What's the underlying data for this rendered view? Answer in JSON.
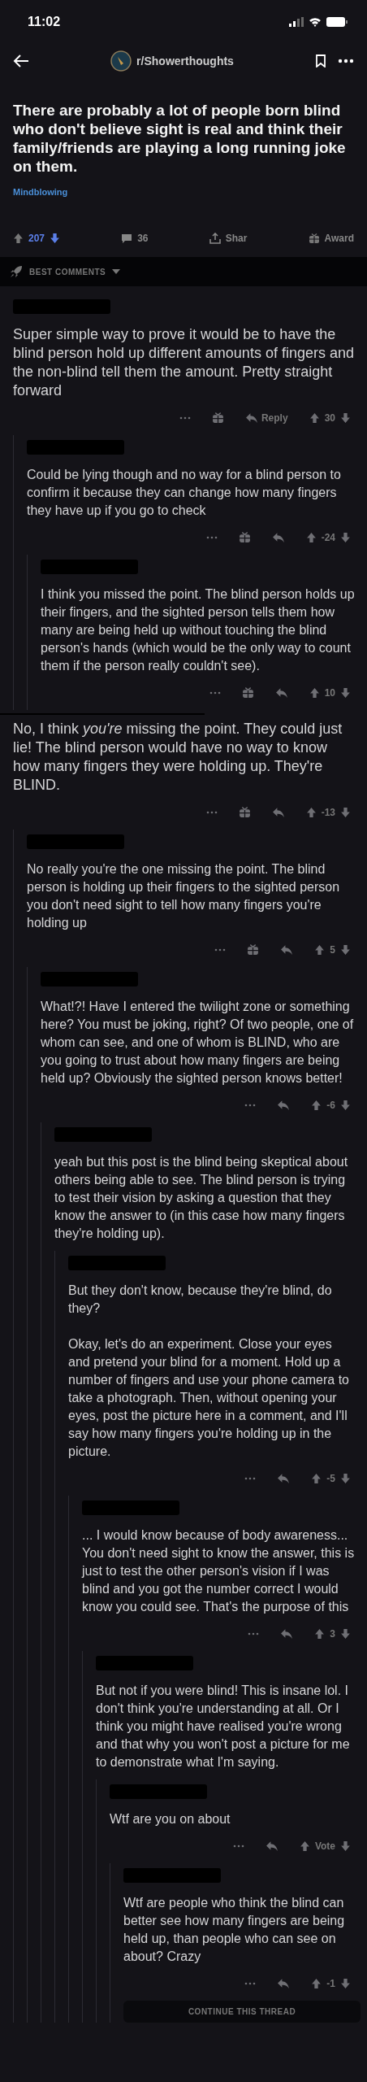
{
  "status_bar": {
    "time": "11:02"
  },
  "header": {
    "subreddit": "r/Showerthoughts"
  },
  "post": {
    "title": "There are probably a lot of people born blind who don't believe sight is real and think their family/friends are playing a long running joke on them.",
    "flair": "Mindblowing",
    "score": "207",
    "upvoted": false,
    "downvoted": true,
    "comments": "36",
    "share": "Shar",
    "award": "Award"
  },
  "sort": {
    "label": "BEST COMMENTS"
  },
  "comments": [
    {
      "text": "Super simple way to prove it would be to have the blind person hold up different amounts of fingers and the non-blind tell them the amount. Pretty straight forward",
      "author_hidden": true,
      "award": true,
      "reply_label": "Reply",
      "score": "30",
      "children": [
        {
          "text": "Could be lying though and no way for a blind person to confirm it because they can change how many fingers they have up if you go to check",
          "author_hidden": true,
          "award": true,
          "score": "-24",
          "children": [
            {
              "text": "I think you missed the point. The blind person holds up their fingers, and the sighted person tells them how many are being held up without touching the blind person's hands (which would be the only way to count them if the person really couldn't see).",
              "author_hidden": true,
              "award": true,
              "score": "10"
            }
          ]
        }
      ]
    },
    {
      "text": "No, I think *you're* missing the point. They could just lie! The blind person would have no way to know how many fingers they were holding up. They're BLIND.",
      "author_hidden": false,
      "award": true,
      "score": "-13",
      "children": [
        {
          "text": "No really you're the one missing the point. The blind person is holding up their fingers to the sighted person you don't need sight to tell how many fingers you're holding up",
          "author_hidden": true,
          "award": true,
          "score": "5",
          "children": [
            {
              "text": "What!?! Have I entered the twilight zone or something here? You must be joking, right? Of two people, one of whom can see, and one of whom is BLIND, who are you going to trust about how many fingers are being held up? Obviously the sighted person knows better!",
              "author_hidden": true,
              "award": false,
              "score": "-6",
              "children": [
                {
                  "text": "yeah but this post is the blind being skeptical about others being able to see. The blind person is trying to test their vision by asking a question that they know the answer to (in this case how many fingers they're holding up).",
                  "author_hidden": true,
                  "children": [
                    {
                      "text": "But they don't know, because they're blind, do they?\n\nOkay, let's do an experiment. Close your eyes and pretend your blind for a moment. Hold up a number of fingers and use your phone camera to take a photograph. Then, without opening your eyes, post the picture here in a comment, and I'll say how many fingers you're holding up in the picture.",
                      "author_hidden": true,
                      "award": false,
                      "score": "-5",
                      "children": [
                        {
                          "text": "... I would know because of body awareness... You don't need sight to know the answer, this is just to test the other person's vision if I was blind and you got the number correct I would know you could see. That's the purpose of this",
                          "author_hidden": true,
                          "award": false,
                          "score": "3",
                          "children": [
                            {
                              "text": "But not if you were blind! This is insane lol. I don't think you're understanding at all. Or I think you might have realised you're wrong and that why you won't post a picture for me to demonstrate what I'm saying.",
                              "author_hidden": true,
                              "children": [
                                {
                                  "text": "Wtf are you on about",
                                  "author_hidden": true,
                                  "award": false,
                                  "score": "Vote",
                                  "children": [
                                    {
                                      "text": "Wtf are people who think the blind can better see how many fingers are being held up, than people who can see on about? Crazy",
                                      "author_hidden": true,
                                      "award": false,
                                      "score": "-1",
                                      "continue_label": "CONTINUE THIS THREAD"
                                    }
                                  ]
                                }
                              ]
                            }
                          ]
                        }
                      ]
                    }
                  ]
                }
              ]
            }
          ]
        }
      ]
    }
  ]
}
